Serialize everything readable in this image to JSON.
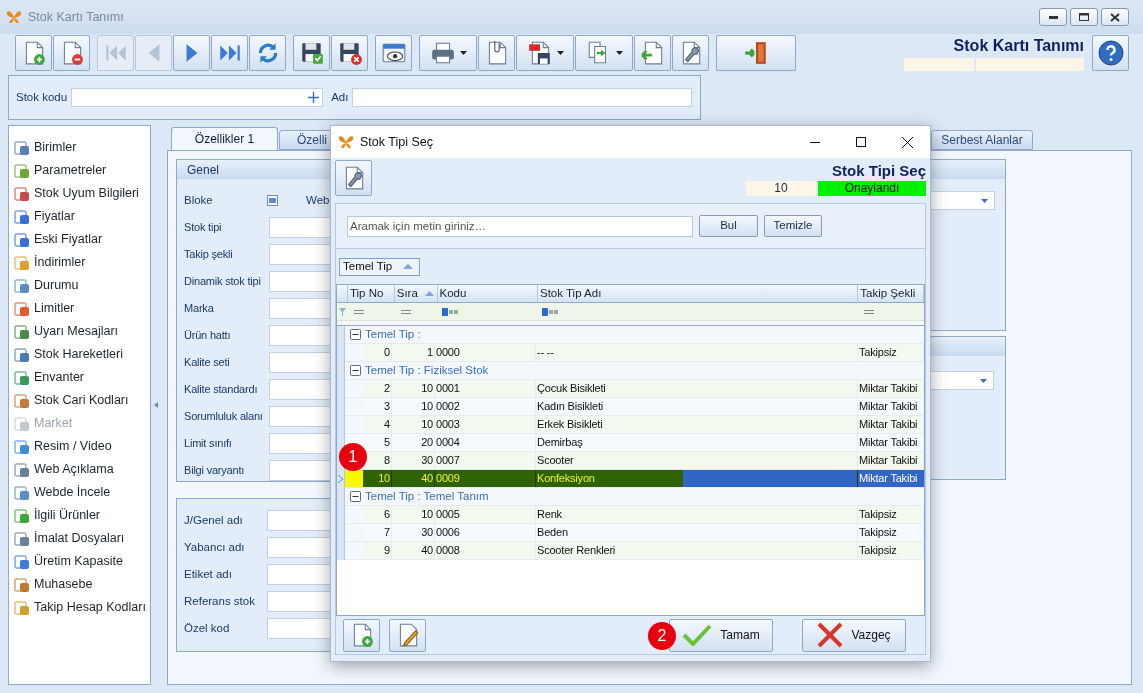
{
  "window": {
    "title": "Stok Kartı Tanımı"
  },
  "toolbar": [
    {
      "kind": "new",
      "disabled": false
    },
    {
      "kind": "delete",
      "disabled": false
    },
    {
      "kind": "first",
      "disabled": true
    },
    {
      "kind": "prev",
      "disabled": true
    },
    {
      "kind": "next",
      "disabled": false
    },
    {
      "kind": "last",
      "disabled": false
    },
    {
      "kind": "refresh",
      "disabled": false
    },
    {
      "kind": "save",
      "disabled": false
    },
    {
      "kind": "discard",
      "disabled": false
    },
    {
      "kind": "preview",
      "disabled": false
    },
    {
      "kind": "print",
      "disabled": false
    },
    {
      "kind": "attach",
      "disabled": false
    },
    {
      "kind": "pdf",
      "disabled": false
    },
    {
      "kind": "export",
      "disabled": false
    },
    {
      "kind": "import",
      "disabled": false
    },
    {
      "kind": "tools",
      "disabled": false
    },
    {
      "kind": "exit",
      "disabled": false
    }
  ],
  "header": {
    "title": "Stok Kartı Tanımı"
  },
  "search_row": {
    "stok_kodu_label": "Stok kodu",
    "adi_label": "Adı"
  },
  "sidebar": {
    "items": [
      {
        "label": "Birimler",
        "disabled": false
      },
      {
        "label": "Parametreler",
        "disabled": false
      },
      {
        "label": "Stok Uyum Bilgileri",
        "disabled": false
      },
      {
        "label": "Fiyatlar",
        "disabled": false
      },
      {
        "label": "Eski Fiyatlar",
        "disabled": false
      },
      {
        "label": "İndirimler",
        "disabled": false
      },
      {
        "label": "Durumu",
        "disabled": false
      },
      {
        "label": "Limitler",
        "disabled": false
      },
      {
        "label": "Uyarı Mesajları",
        "disabled": false
      },
      {
        "label": "Stok Hareketleri",
        "disabled": false
      },
      {
        "label": "Envanter",
        "disabled": false
      },
      {
        "label": "Stok Cari Kodları",
        "disabled": false
      },
      {
        "label": "Market",
        "disabled": true
      },
      {
        "label": "Resim / Video",
        "disabled": false
      },
      {
        "label": "Web Açıklama",
        "disabled": false
      },
      {
        "label": "Webde İncele",
        "disabled": false
      },
      {
        "label": "İlgili Ürünler",
        "disabled": false
      },
      {
        "label": "İmalat Dosyaları",
        "disabled": false
      },
      {
        "label": "Üretim Kapasite",
        "disabled": false
      },
      {
        "label": "Muhasebe",
        "disabled": false
      },
      {
        "label": "Takip Hesap Kodları",
        "disabled": false
      }
    ]
  },
  "tabs": [
    {
      "label": "Özellikler 1",
      "selected": true
    },
    {
      "label": "Özelli",
      "selected": false
    },
    {
      "label": "Serbest Alanlar",
      "selected": false
    }
  ],
  "genel": {
    "title": "Genel",
    "bloke_label": "Bloke",
    "web_label": "Web",
    "fields": [
      "Stok tipi",
      "Takip şekli",
      "Dinamik stok tipi",
      "Marka",
      "Ürün hattı",
      "Kalite seti",
      "Kalite standardı",
      "Sorumluluk alanı",
      "Limit sınıfı",
      "Bilgi varyantı"
    ]
  },
  "names_group": {
    "fields": [
      "J/Genel adı",
      "Yabancı adı",
      "Etiket adı",
      "Referans stok",
      "Özel kod"
    ]
  },
  "dialog": {
    "title": "Stok Tipi Seç",
    "header_title": "Stok Tipi Seç",
    "number": "10",
    "status": "Onaylandı",
    "search_placeholder": "Aramak için metin giriniz…",
    "find_button": "Bul",
    "clear_button": "Temizle",
    "group_chip": "Temel Tip",
    "columns": [
      "Tip No",
      "Sıra",
      "Kodu",
      "Stok Tip Adı",
      "Takip Şekli"
    ],
    "groups": [
      {
        "label": "Temel Tip :",
        "expanded": true,
        "rows": [
          {
            "tip_no": "0",
            "sira": "1",
            "kodu": "0000",
            "ad": "-- --",
            "takip": "Takipsiz",
            "selected": false
          }
        ]
      },
      {
        "label": "Temel Tip : Fiziksel Stok",
        "expanded": true,
        "rows": [
          {
            "tip_no": "2",
            "sira": "10",
            "kodu": "0001",
            "ad": "Çocuk Bisikleti",
            "takip": "Miktar Takibi",
            "selected": false
          },
          {
            "tip_no": "3",
            "sira": "10",
            "kodu": "0002",
            "ad": "Kadın Bisikleti",
            "takip": "Miktar Takibi",
            "selected": false
          },
          {
            "tip_no": "4",
            "sira": "10",
            "kodu": "0003",
            "ad": "Erkek  Bisikleti",
            "takip": "Miktar Takibi",
            "selected": false
          },
          {
            "tip_no": "5",
            "sira": "20",
            "kodu": "0004",
            "ad": "Demirbaş",
            "takip": "Miktar Takibi",
            "selected": false
          },
          {
            "tip_no": "8",
            "sira": "30",
            "kodu": "0007",
            "ad": "Scooter",
            "takip": "Miktar Takibi",
            "selected": false
          },
          {
            "tip_no": "10",
            "sira": "40",
            "kodu": "0009",
            "ad": "Konfeksiyon",
            "takip": "Miktar Takibi",
            "selected": true
          }
        ]
      },
      {
        "label": "Temel Tip : Temel Tanım",
        "expanded": true,
        "rows": [
          {
            "tip_no": "6",
            "sira": "10",
            "kodu": "0005",
            "ad": "Renk",
            "takip": "Takipsiz",
            "selected": false
          },
          {
            "tip_no": "7",
            "sira": "30",
            "kodu": "0006",
            "ad": "Beden",
            "takip": "Takipsiz",
            "selected": false
          },
          {
            "tip_no": "9",
            "sira": "40",
            "kodu": "0008",
            "ad": "Scooter Renkleri",
            "takip": "Takipsiz",
            "selected": false
          }
        ]
      }
    ],
    "ok_button": "Tamam",
    "cancel_button": "Vazgeç",
    "markers": [
      "1",
      "2"
    ]
  }
}
